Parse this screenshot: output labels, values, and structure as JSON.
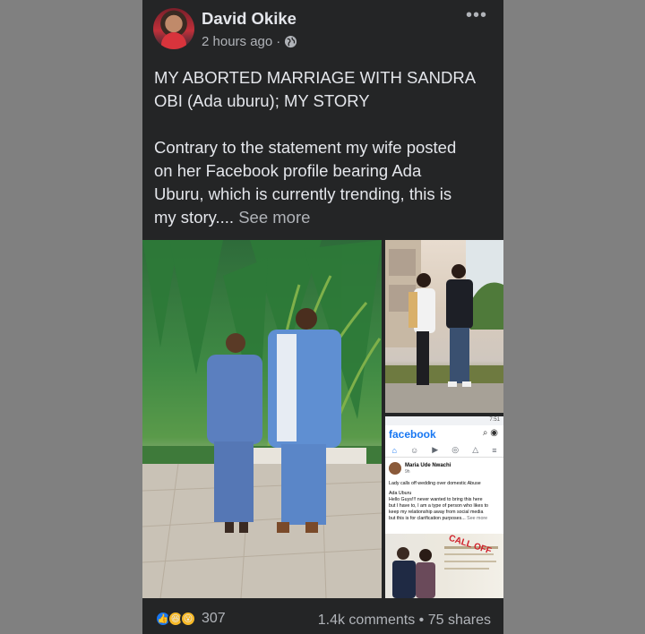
{
  "post": {
    "author": "David Okike",
    "time": "2 hours ago",
    "title_line1": "MY ABORTED MARRIAGE WITH SANDRA",
    "title_line2": "OBI (Ada uburu); MY STORY",
    "body_line1": "Contrary to the statement my wife posted",
    "body_line2": "on her Facebook profile bearing Ada",
    "body_line3": "Uburu, which is currently trending, this is",
    "body_line4": "my story....",
    "see_more": "See more"
  },
  "embedded_screenshot": {
    "status": "7:51",
    "logo": "facebook",
    "post_author": "Maria Ude Nwachi",
    "post_time": "9h",
    "line1": "Lady calls off wedding over domestic Abuse",
    "line2": "Ada Uburu",
    "line3": "Hello Guys!!! never wanted to bring this here",
    "line4": "but I have to, I am a type of person who likes to",
    "line5": "keep my relationship away from social media",
    "line6": "but this is for clarification purposes...",
    "see_more": "See more",
    "stamp": "CALL OFF"
  },
  "footer": {
    "reaction_count": "307",
    "comments": "1.4k comments",
    "separator": "•",
    "shares": "75 shares"
  },
  "icons": {
    "privacy": "globe-icon",
    "menu": "more-options-icon",
    "reactions": [
      "like-icon",
      "haha-icon",
      "wow-icon"
    ]
  },
  "colors": {
    "card_bg": "#242526",
    "text": "#e4e6eb",
    "secondary_text": "#b0b3b8",
    "page_bg": "#808080",
    "facebook_blue": "#1877f2"
  }
}
